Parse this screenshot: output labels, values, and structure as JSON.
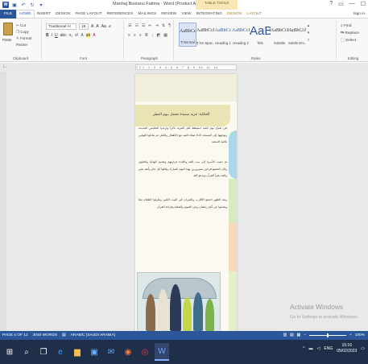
{
  "titlebar": {
    "doc_title": "Manhaj Bustanu Fatima - Word (Product Activation Failed)",
    "context_group": "TABLE TOOLS",
    "win_help": "?",
    "win_minimize": "—",
    "win_restore": "☐"
  },
  "ribbon_tabs": {
    "file": "FILE",
    "tabs": [
      "HOME",
      "INSERT",
      "DESIGN",
      "PAGE LAYOUT",
      "REFERENCES",
      "MAILINGS",
      "REVIEW",
      "VIEW",
      "INTEGRATING"
    ],
    "context_tabs": [
      "DESIGN",
      "LAYOUT"
    ],
    "active": "HOME",
    "signin": "Sign in"
  },
  "clipboard": {
    "paste": "Paste",
    "cut": "Cut",
    "copy": "Copy",
    "format_painter": "Format Painter",
    "label": "Clipboard"
  },
  "font": {
    "family": "Traditional Ar",
    "size": "16",
    "label": "Font"
  },
  "paragraph": {
    "label": "Paragraph"
  },
  "styles": {
    "items": [
      {
        "sample": "AaBbCcDc",
        "name": "¶ Normal"
      },
      {
        "sample": "AaBbCcDc",
        "name": "¶ No Spac..."
      },
      {
        "sample": "AaBbCc",
        "name": "Heading 1"
      },
      {
        "sample": "AaBbCcI",
        "name": "Heading 2"
      },
      {
        "sample": "AaB",
        "name": "Title"
      },
      {
        "sample": "AaBbCcD",
        "name": "Subtitle"
      },
      {
        "sample": "AaBbCcDa",
        "name": "Subtle Em..."
      }
    ],
    "label": "Styles"
  },
  "editing": {
    "find": "Find",
    "replace": "Replace",
    "select": "Select",
    "label": "Editing"
  },
  "ruler": {
    "marks": "1 2 1 · 1 · 2 · 3 · 4 · 5 · 6 · 7 · 8 · 9 · 10 · 11 · 12"
  },
  "document": {
    "heading": "الحكاية: قرية سعيدة تحتفل بيوم الفطر",
    "paragraphs": [
      "في صباح يوم العيد استيقظ أهل القرية باكرا وارتدوا الملابس الجديدة وتوجهوا إلى المسجد لأداء صلاة العيد مع الأطفال والكبار ثم تبادلوا التهاني بالعيد السعيد",
      "ثم ذهبت الأسرة إلى بيت الجد والجدة لزيارتهم وتقديم الهدايا والحلوى وكان الجميع فرحين مسرورين بهذا اليوم المبارك وقالوا كل عام وأنتم بخير والجد يقرأ القرآن ويدعو الله",
      "وبعد الظهر اجتمع الأقارب والجيران في البيت الكبير وتناولوا الطعام معا وتحدثوا عن أيام رمضان وعن الصوم والصلاة وقراءة القرآن"
    ]
  },
  "watermark": {
    "title": "Activate Windows",
    "subtitle": "Go to Settings to activate Windows."
  },
  "statusbar": {
    "page": "PAGE 4 OF 12",
    "words": "3040 WORDS",
    "language": "ARABIC (SAUDI ARABIA)",
    "zoom": "100%"
  },
  "taskbar": {
    "time": "15:16",
    "date": "05/02/2023",
    "lang": "ENG"
  },
  "colors": {
    "word_blue": "#2b579a",
    "taskbar": "#1f2f4a",
    "banner": "#eae3b4"
  }
}
